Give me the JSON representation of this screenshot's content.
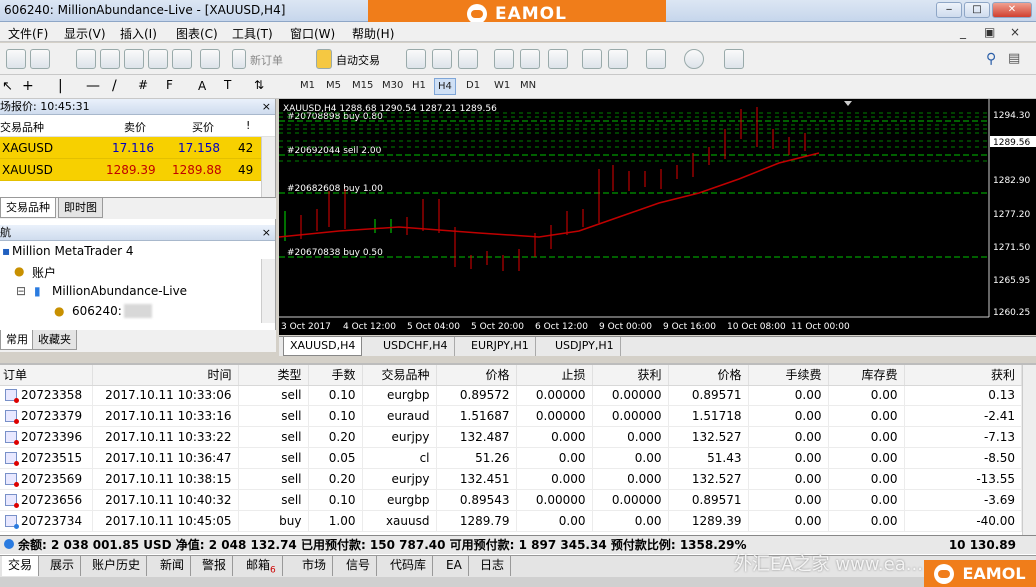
{
  "window": {
    "title": "606240: MillionAbundance-Live - [XAUUSD,H4]",
    "brand": "EAMOL",
    "btn_min": "‒",
    "btn_max": "□",
    "btn_close": "✕"
  },
  "menu": [
    "文件(F)",
    "显示(V)",
    "插入(I)",
    "图表(C)",
    "工具(T)",
    "窗口(W)",
    "帮助(H)"
  ],
  "toolbar": {
    "new_order": "新订单",
    "auto_trade": "自动交易"
  },
  "timeframes": [
    "M1",
    "M5",
    "M15",
    "M30",
    "H1",
    "H4",
    "D1",
    "W1",
    "MN"
  ],
  "timeframe_selected": "H4",
  "market_watch": {
    "header": "场报价: 10:45:31",
    "columns": [
      "交易品种",
      "卖价",
      "买价",
      "!"
    ],
    "rows": [
      {
        "symbol": "XAGUSD",
        "bid": "17.116",
        "ask": "17.158",
        "spread": "42"
      },
      {
        "symbol": "XAUUSD",
        "bid": "1289.39",
        "ask": "1289.88",
        "spread": "49"
      }
    ],
    "tabs": [
      "交易品种",
      "即时图"
    ]
  },
  "navigator": {
    "header": "航",
    "items": [
      "Million MetaTrader 4",
      "账户",
      "MillionAbundance-Live",
      "606240:"
    ],
    "tabs": [
      "常用",
      "收藏夹"
    ]
  },
  "chart": {
    "info": "XAUUSD,H4  1288.68 1290.54 1287.21 1289.56",
    "price_labels": [
      "1294.30",
      "1289.56",
      "1282.90",
      "1277.20",
      "1271.50",
      "1265.95",
      "1260.25"
    ],
    "time_labels": [
      "3 Oct 2017",
      "4 Oct 12:00",
      "5 Oct 04:00",
      "5 Oct 20:00",
      "6 Oct 12:00",
      "9 Oct 00:00",
      "9 Oct 16:00",
      "10 Oct 08:00",
      "11 Oct 00:00"
    ],
    "order_lines": [
      "#20708898 buy 0.80",
      "#20692044 sell 2.00",
      "#20682608 buy 1.00",
      "#20670838 buy 0.50"
    ],
    "current_price": "1289.56",
    "colors": {
      "bull": "#00e000",
      "bear": "#e00000",
      "ma": "#c00000",
      "order_line": "#00c000"
    }
  },
  "chart_tabs": [
    "XAUUSD,H4",
    "USDCHF,H4",
    "EURJPY,H1",
    "USDJPY,H1"
  ],
  "terminal": {
    "columns": [
      "订单",
      "时间",
      "类型",
      "手数",
      "交易品种",
      "价格",
      "止损",
      "获利",
      "价格",
      "手续费",
      "库存费",
      "获利"
    ],
    "rows": [
      [
        "20723358",
        "2017.10.11 10:33:06",
        "sell",
        "0.10",
        "eurgbp",
        "0.89572",
        "0.00000",
        "0.00000",
        "0.89571",
        "0.00",
        "0.00",
        "0.13"
      ],
      [
        "20723379",
        "2017.10.11 10:33:16",
        "sell",
        "0.10",
        "euraud",
        "1.51687",
        "0.00000",
        "0.00000",
        "1.51718",
        "0.00",
        "0.00",
        "-2.41"
      ],
      [
        "20723396",
        "2017.10.11 10:33:22",
        "sell",
        "0.20",
        "eurjpy",
        "132.487",
        "0.000",
        "0.000",
        "132.527",
        "0.00",
        "0.00",
        "-7.13"
      ],
      [
        "20723515",
        "2017.10.11 10:36:47",
        "sell",
        "0.05",
        "cl",
        "51.26",
        "0.00",
        "0.00",
        "51.43",
        "0.00",
        "0.00",
        "-8.50"
      ],
      [
        "20723569",
        "2017.10.11 10:38:15",
        "sell",
        "0.20",
        "eurjpy",
        "132.451",
        "0.000",
        "0.000",
        "132.527",
        "0.00",
        "0.00",
        "-13.55"
      ],
      [
        "20723656",
        "2017.10.11 10:40:32",
        "sell",
        "0.10",
        "eurgbp",
        "0.89543",
        "0.00000",
        "0.00000",
        "0.89571",
        "0.00",
        "0.00",
        "-3.69"
      ],
      [
        "20723734",
        "2017.10.11 10:45:05",
        "buy",
        "1.00",
        "xauusd",
        "1289.79",
        "0.00",
        "0.00",
        "1289.39",
        "0.00",
        "0.00",
        "-40.00"
      ]
    ],
    "balance_line": "余额: 2 038 001.85 USD  净值: 2 048 132.74  已用预付款: 150 787.40  可用预付款: 1 897 345.34  预付款比例: 1358.29%",
    "total_profit": "10 130.89",
    "tabs": [
      "交易",
      "展示",
      "账户历史",
      "新闻",
      "警报",
      "邮箱",
      "市场",
      "信号",
      "代码库",
      "EA",
      "日志"
    ],
    "mail_count": "6"
  },
  "watermark": {
    "text": "外汇EA之家 www.ea...",
    "brand": "EAMOL"
  }
}
